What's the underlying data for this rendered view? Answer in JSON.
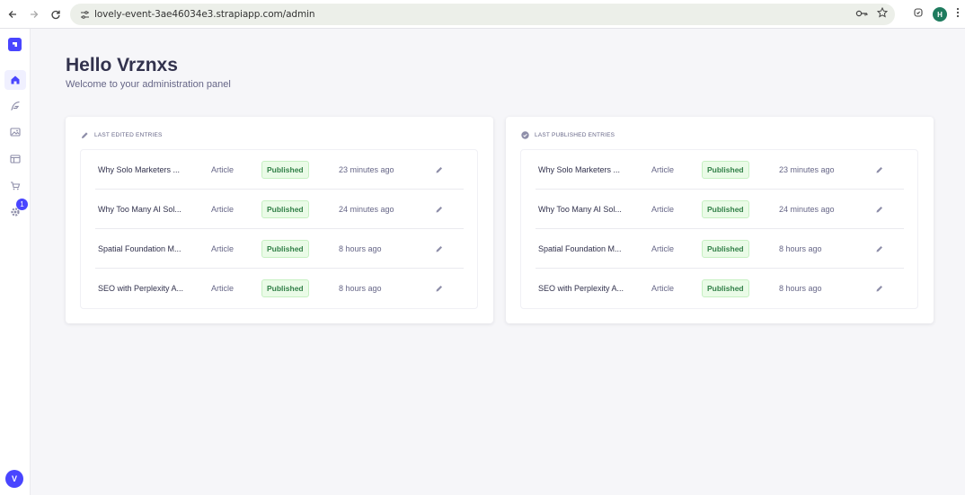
{
  "browser": {
    "url": "lovely-event-3ae46034e3.strapiapp.com/admin",
    "profile_initial": "H"
  },
  "sidebar": {
    "notification_count": "1",
    "user_initial": "V",
    "items": [
      {
        "name": "home-icon",
        "active": true
      },
      {
        "name": "feather-icon",
        "active": false
      },
      {
        "name": "image-icon",
        "active": false
      },
      {
        "name": "layout-icon",
        "active": false
      },
      {
        "name": "cart-icon",
        "active": false
      },
      {
        "name": "gear-icon",
        "active": false
      }
    ]
  },
  "header": {
    "title": "Hello Vrznxs",
    "subtitle": "Welcome to your administration panel"
  },
  "last_edited": {
    "label": "LAST EDITED ENTRIES",
    "rows": [
      {
        "title": "Why Solo Marketers ...",
        "type": "Article",
        "status": "Published",
        "time": "23 minutes ago"
      },
      {
        "title": "Why Too Many AI Sol...",
        "type": "Article",
        "status": "Published",
        "time": "24 minutes ago"
      },
      {
        "title": "Spatial Foundation M...",
        "type": "Article",
        "status": "Published",
        "time": "8 hours ago"
      },
      {
        "title": "SEO with Perplexity A...",
        "type": "Article",
        "status": "Published",
        "time": "8 hours ago"
      }
    ]
  },
  "last_published": {
    "label": "LAST PUBLISHED ENTRIES",
    "rows": [
      {
        "title": "Why Solo Marketers ...",
        "type": "Article",
        "status": "Published",
        "time": "23 minutes ago"
      },
      {
        "title": "Why Too Many AI Sol...",
        "type": "Article",
        "status": "Published",
        "time": "24 minutes ago"
      },
      {
        "title": "Spatial Foundation M...",
        "type": "Article",
        "status": "Published",
        "time": "8 hours ago"
      },
      {
        "title": "SEO with Perplexity A...",
        "type": "Article",
        "status": "Published",
        "time": "8 hours ago"
      }
    ]
  },
  "colors": {
    "accent": "#4945ff",
    "success_text": "#328048",
    "success_bg": "#eafbe7"
  }
}
